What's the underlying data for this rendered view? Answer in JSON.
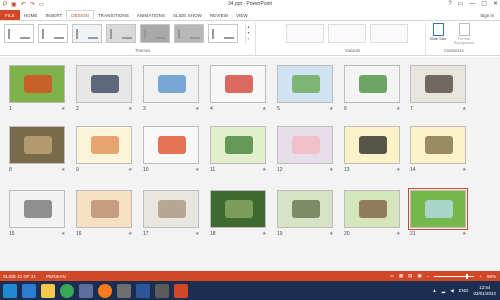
{
  "window": {
    "title": "34.ppt - PowerPoint",
    "controls": [
      "?",
      "▭",
      "—",
      "▢",
      "✕"
    ]
  },
  "qat": {
    "icons": [
      "save-icon",
      "undo-icon",
      "redo-icon",
      "slideshow-icon"
    ]
  },
  "tabs": [
    "FILE",
    "HOME",
    "INSERT",
    "DESIGN",
    "TRANSITIONS",
    "ANIMATIONS",
    "SLIDE SHOW",
    "REVIEW",
    "VIEW"
  ],
  "active_tab": "DESIGN",
  "signin": "Sign in",
  "ribbon": {
    "themes_label": "Themes",
    "variants_label": "Variants",
    "customize_label": "Customize",
    "slide_size": "Slide Size",
    "format_background": "Format Background",
    "theme_colors": [
      "#ffffff",
      "#4472c4",
      "#ffc000",
      "#f4b183",
      "#a5a5a5",
      "#bfbfbf",
      "#7f7f7f"
    ]
  },
  "slides": [
    {
      "n": "1",
      "bg": "#7fb24a",
      "accent": "#e0451f",
      "star": "★"
    },
    {
      "n": "2",
      "bg": "#e7e7e7",
      "accent": "#2f3d5a",
      "star": "★"
    },
    {
      "n": "3",
      "bg": "#f1f1f1",
      "accent": "#4f8ecb",
      "star": "★"
    },
    {
      "n": "4",
      "bg": "#f7f7f7",
      "accent": "#d23a2e",
      "star": "★"
    },
    {
      "n": "5",
      "bg": "#cfe3f2",
      "accent": "#64a74c",
      "star": "★"
    },
    {
      "n": "6",
      "bg": "#f4f4f4",
      "accent": "#3f8b34",
      "star": "★"
    },
    {
      "n": "7",
      "bg": "#e8e5df",
      "accent": "#4a3d34",
      "star": "★"
    },
    {
      "n": "8",
      "bg": "#7a6a4c",
      "accent": "#c7ab7a",
      "star": "★"
    },
    {
      "n": "9",
      "bg": "#fbf4d9",
      "accent": "#e08a4a",
      "star": "★"
    },
    {
      "n": "10",
      "bg": "#f8f8f8",
      "accent": "#e0451f",
      "star": "★"
    },
    {
      "n": "11",
      "bg": "#e3efcc",
      "accent": "#3a7d2f",
      "star": "★"
    },
    {
      "n": "12",
      "bg": "#e6dfe8",
      "accent": "#f6b6c0",
      "star": "★"
    },
    {
      "n": "13",
      "bg": "#fbf2c7",
      "accent": "#222222",
      "star": "★"
    },
    {
      "n": "14",
      "bg": "#fbf2c7",
      "accent": "#7a6a3c",
      "star": "★"
    },
    {
      "n": "15",
      "bg": "#f2f2f2",
      "accent": "#6d6d6d",
      "star": "★"
    },
    {
      "n": "16",
      "bg": "#f5e1c2",
      "accent": "#b6866a",
      "star": "★"
    },
    {
      "n": "17",
      "bg": "#e8e6e0",
      "accent": "#a89276",
      "star": "★"
    },
    {
      "n": "18",
      "bg": "#3f6a2f",
      "accent": "#8fb06a",
      "star": "★"
    },
    {
      "n": "19",
      "bg": "#d6e3c5",
      "accent": "#5f6c45",
      "star": "★"
    },
    {
      "n": "20",
      "bg": "#d5e6bc",
      "accent": "#7a5a3e",
      "star": "★"
    },
    {
      "n": "21",
      "bg": "#74b84b",
      "accent": "#bcdcf4",
      "star": "★"
    }
  ],
  "selected_slide": "21",
  "status": {
    "slide_info": "SLIDE 21 OF 21",
    "language": "PERSIAN",
    "zoom": "66%"
  },
  "taskbar": {
    "icons": [
      "windows-start-icon",
      "ie-icon",
      "explorer-icon",
      "chrome-icon",
      "media-icon",
      "firefox-icon",
      "app-icon",
      "word-icon",
      "settings-icon",
      "powerpoint-icon"
    ],
    "time": "13:54",
    "date": "03/01/2022",
    "lang": "ENG"
  }
}
